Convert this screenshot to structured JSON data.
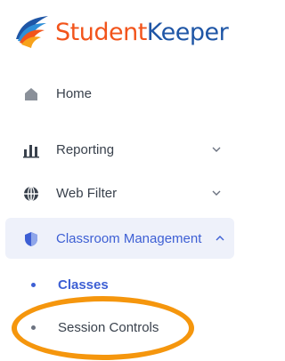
{
  "brand": {
    "part1": "Student",
    "part2": "Keeper"
  },
  "colors": {
    "brand_orange": "#f2541b",
    "brand_blue": "#1f56a6",
    "active_blue": "#3d5fd4",
    "annotation_orange": "#f5960d"
  },
  "nav": {
    "home": {
      "label": "Home",
      "icon": "home-icon"
    },
    "reporting": {
      "label": "Reporting",
      "icon": "bar-chart-icon"
    },
    "web_filter": {
      "label": "Web Filter",
      "icon": "globe-icon"
    },
    "classroom": {
      "label": "Classroom Management",
      "icon": "shield-icon",
      "expanded": true,
      "sub_items": [
        {
          "label": "Classes",
          "active": true
        },
        {
          "label": "Session Controls",
          "active": false
        }
      ]
    }
  }
}
